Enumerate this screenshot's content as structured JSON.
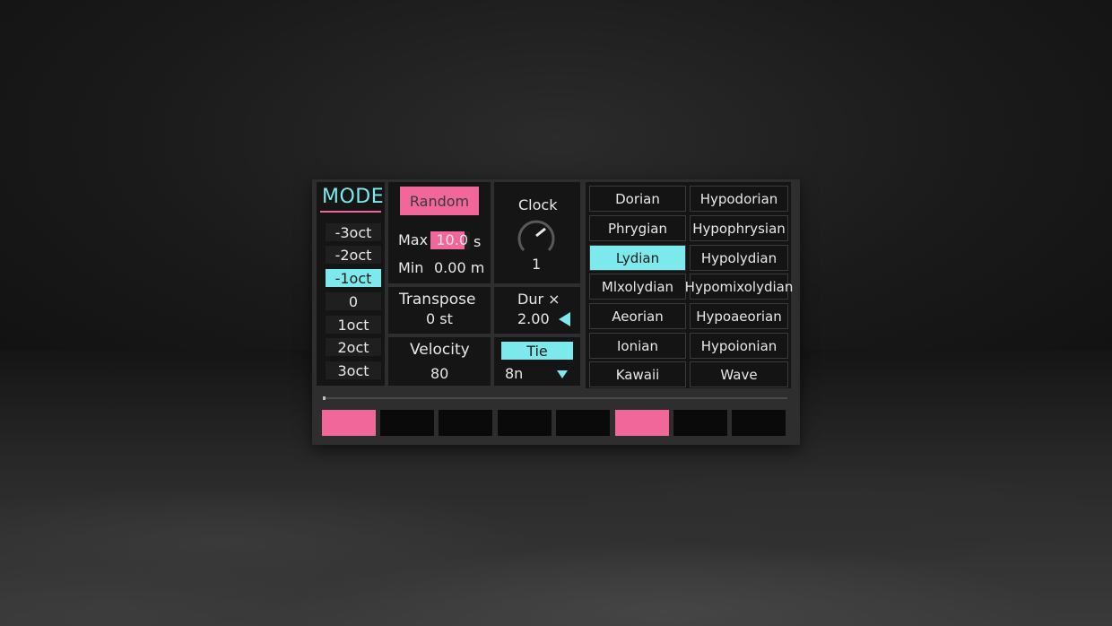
{
  "mode": {
    "title": "MODE",
    "octaves": [
      "-3oct",
      "-2oct",
      "-1oct",
      "0",
      "1oct",
      "2oct",
      "3oct"
    ],
    "selected_index": 2
  },
  "random": {
    "button_label": "Random",
    "max_label": "Max",
    "max_value": "10.0",
    "max_unit": "s",
    "min_label": "Min",
    "min_value": "0.00 m"
  },
  "clock": {
    "label": "Clock",
    "value": "1"
  },
  "transpose": {
    "label": "Transpose",
    "value": "0 st"
  },
  "duration": {
    "label": "Dur ×",
    "value": "2.00"
  },
  "velocity": {
    "label": "Velocity",
    "value": "80"
  },
  "tie": {
    "label": "Tie",
    "note_value": "8n"
  },
  "scales": {
    "left": [
      "Dorian",
      "Phrygian",
      "Lydian",
      "Mlxolydian",
      "Aeorian",
      "Ionian",
      "Kawaii"
    ],
    "right": [
      "Hypodorian",
      "Hypophrysian",
      "Hypolydian",
      "Hypomixolydian",
      "Hypoaeorian",
      "Hypoionian",
      "Wave"
    ],
    "selected": "Lydian"
  },
  "steps": [
    true,
    false,
    false,
    false,
    false,
    true,
    false,
    false
  ],
  "colors": {
    "accent_pink": "#f2679a",
    "accent_cyan": "#7ce9ec",
    "panel_bg": "#151515"
  }
}
